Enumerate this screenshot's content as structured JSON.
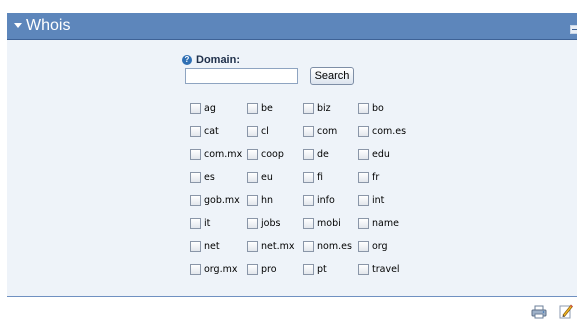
{
  "panel": {
    "title": "Whois"
  },
  "form": {
    "domain_label": "Domain:",
    "domain_value": "",
    "domain_placeholder": "",
    "search_label": "Search"
  },
  "tlds": [
    [
      "ag",
      "be",
      "biz",
      "bo"
    ],
    [
      "cat",
      "cl",
      "com",
      "com.es"
    ],
    [
      "com.mx",
      "coop",
      "de",
      "edu"
    ],
    [
      "es",
      "eu",
      "fi",
      "fr"
    ],
    [
      "gob.mx",
      "hn",
      "info",
      "int"
    ],
    [
      "it",
      "jobs",
      "mobi",
      "name"
    ],
    [
      "net",
      "net.mx",
      "nom.es",
      "org"
    ],
    [
      "org.mx",
      "pro",
      "pt",
      "travel"
    ]
  ],
  "icons": {
    "header": "triangle-down-icon",
    "collapse": "minimize-icon",
    "help": "help-icon",
    "print": "print-icon",
    "edit": "edit-icon"
  },
  "colors": {
    "header_bg": "#5d86bb",
    "body_bg": "#eef3f9",
    "help": "#2f6fb4"
  }
}
